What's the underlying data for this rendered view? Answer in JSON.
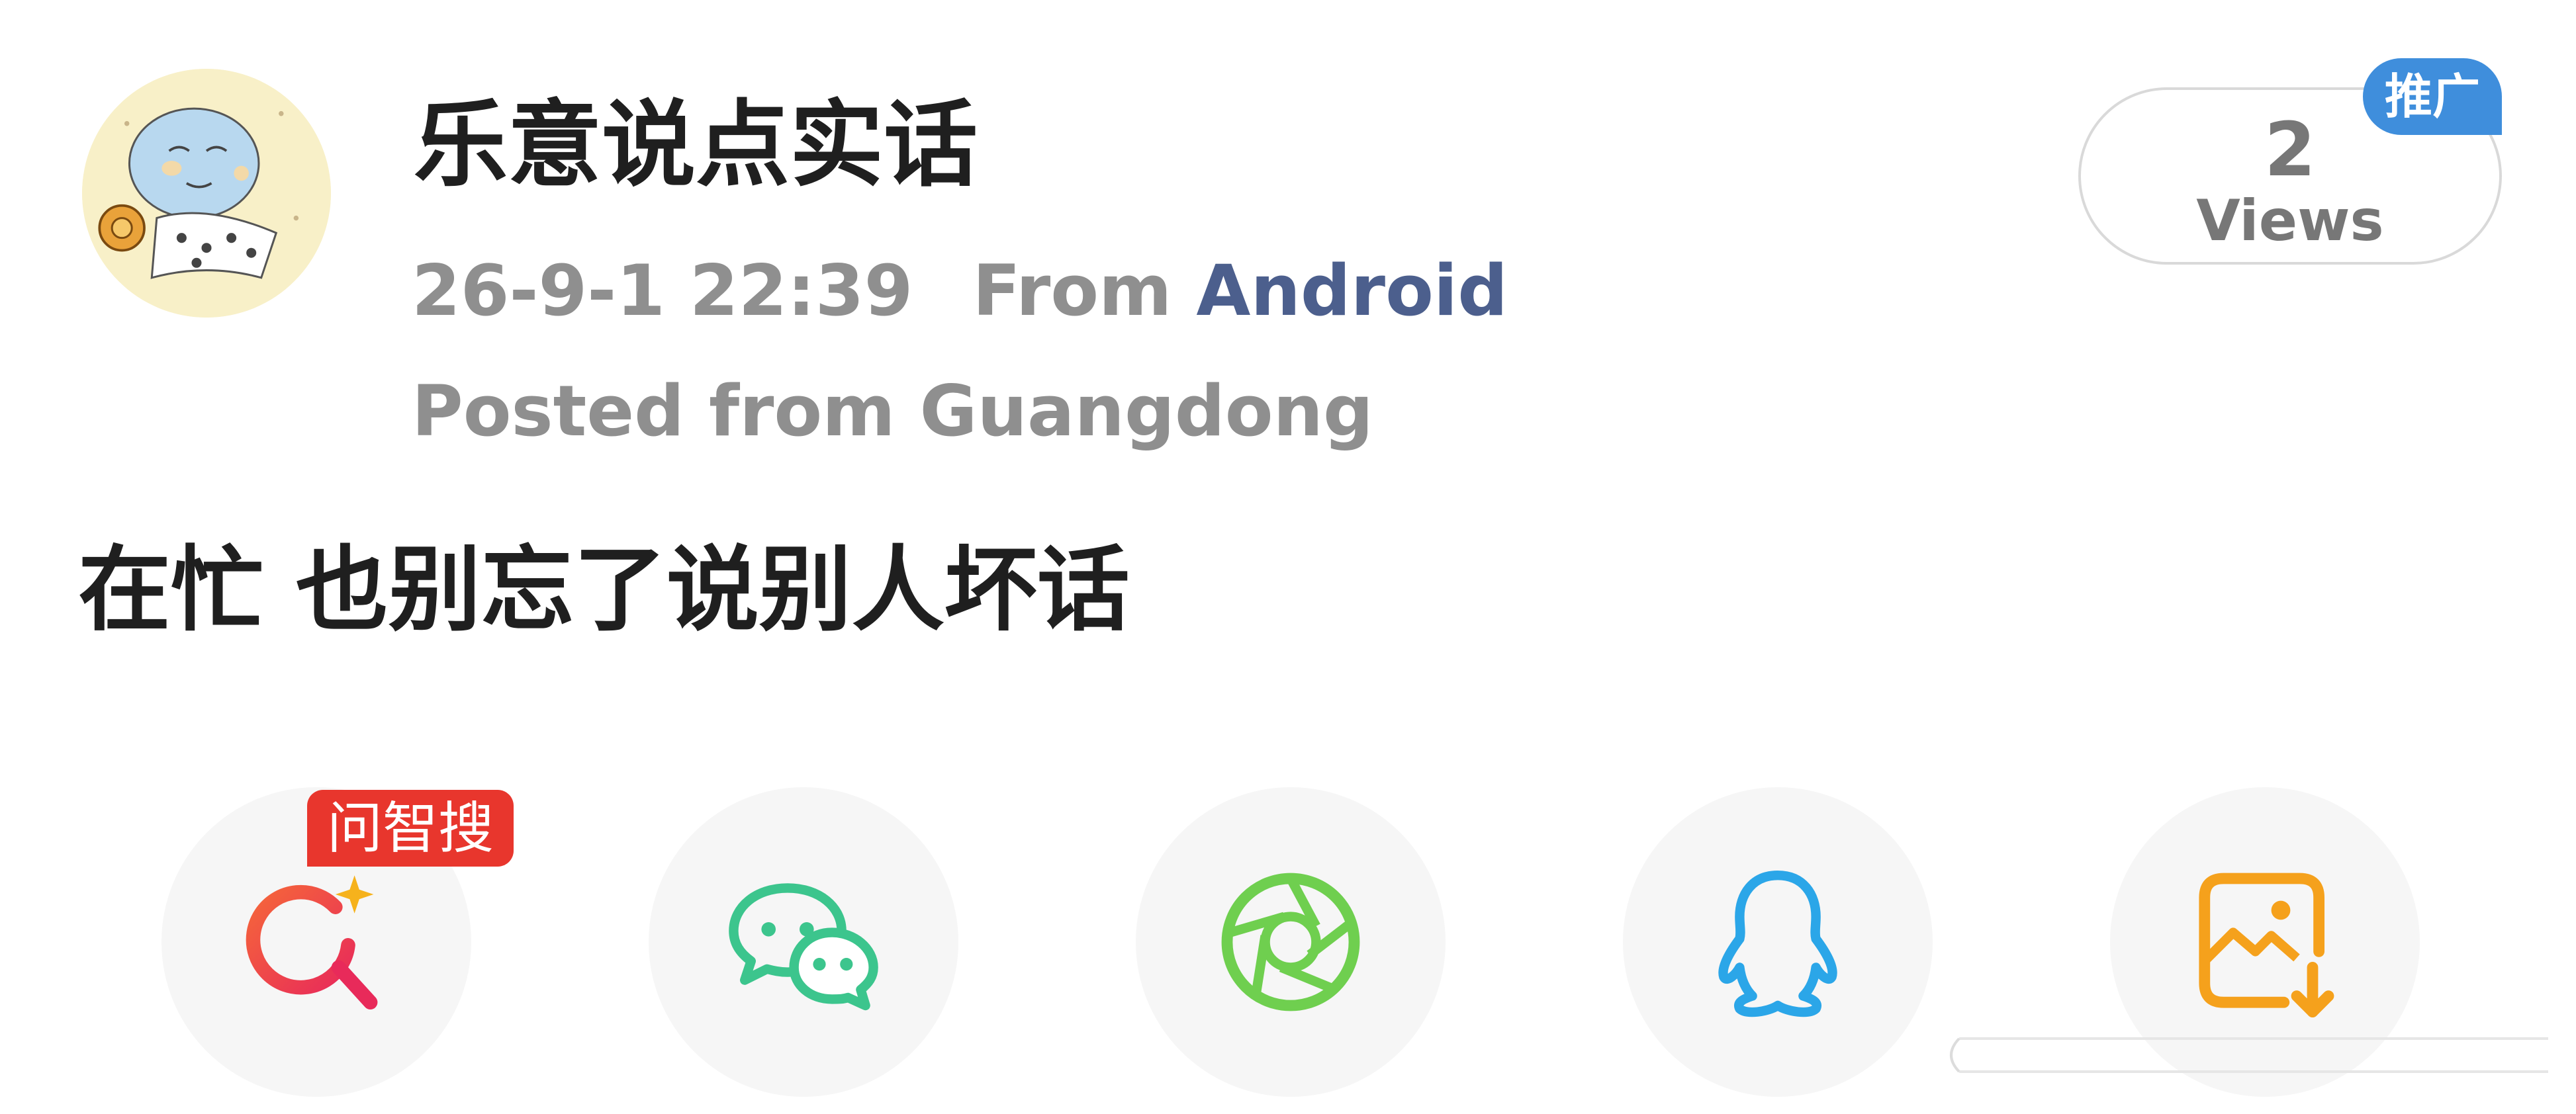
{
  "post": {
    "author_name": "乐意说点实话",
    "timestamp": "26-9-1 22:39",
    "source_prefix": "From",
    "source_device": "Android",
    "location": "Posted from Guangdong",
    "content": "在忙 也别忘了说别人坏话"
  },
  "views": {
    "count": "2",
    "label": "Views",
    "promo_badge": "推广"
  },
  "share_bar": {
    "ai_badge": "问智搜",
    "buttons": [
      {
        "name": "ai-search",
        "icon": "ai-search-icon",
        "color": "#e8362d"
      },
      {
        "name": "wechat",
        "icon": "wechat-icon",
        "color": "#3cc58d"
      },
      {
        "name": "moments",
        "icon": "moments-shutter-icon",
        "color": "#6fcf4f"
      },
      {
        "name": "qq",
        "icon": "qq-penguin-icon",
        "color": "#2ba6e8"
      },
      {
        "name": "save-image",
        "icon": "save-image-icon",
        "color": "#f5a11c"
      }
    ]
  },
  "colors": {
    "source_link": "#4c5f8d",
    "promo_badge": "#3f8edc",
    "ai_badge": "#e8362d"
  }
}
